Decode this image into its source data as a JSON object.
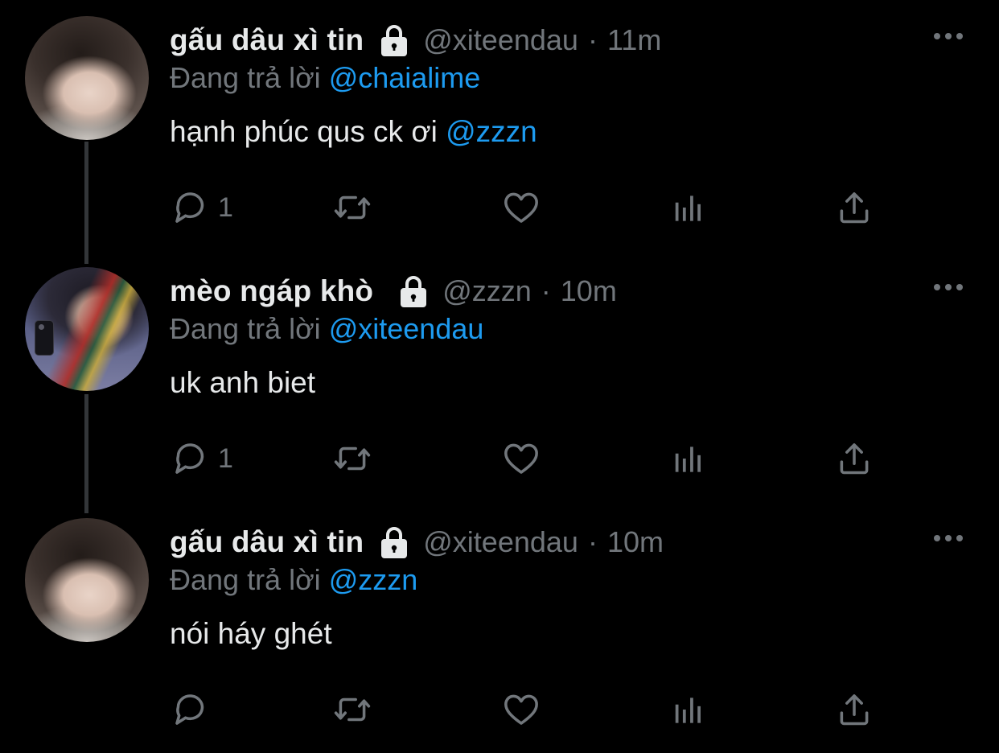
{
  "colors": {
    "background": "#000000",
    "primary_text": "#e7e9ea",
    "secondary_text": "#71767b",
    "mention": "#1d9bf0",
    "thread_line": "#333639"
  },
  "icons": {
    "lock": "lock-icon",
    "more": "more-horizontal-icon",
    "reply": "reply-bubble-icon",
    "retweet": "retweet-icon",
    "like": "heart-icon",
    "views": "analytics-bars-icon",
    "share": "share-upload-icon"
  },
  "tweets": [
    {
      "display_name": "gấu dâu xì tin",
      "handle": "@xiteendau",
      "separator": "·",
      "time": "11m",
      "replying_prefix": "Đang trả lời",
      "replying_to": "@chaialime",
      "text": "hạnh phúc qus ck ơi",
      "text_mention": "@zzzn",
      "reply_count": "1"
    },
    {
      "display_name": "mèo ngáp khò",
      "handle": "@zzzn",
      "separator": "·",
      "time": "10m",
      "replying_prefix": "Đang trả lời",
      "replying_to": "@xiteendau",
      "text": "uk anh biet",
      "text_mention": "",
      "reply_count": "1"
    },
    {
      "display_name": "gấu dâu xì tin",
      "handle": "@xiteendau",
      "separator": "·",
      "time": "10m",
      "replying_prefix": "Đang trả lời",
      "replying_to": "@zzzn",
      "text": "nói háy ghét",
      "text_mention": "",
      "reply_count": ""
    }
  ]
}
